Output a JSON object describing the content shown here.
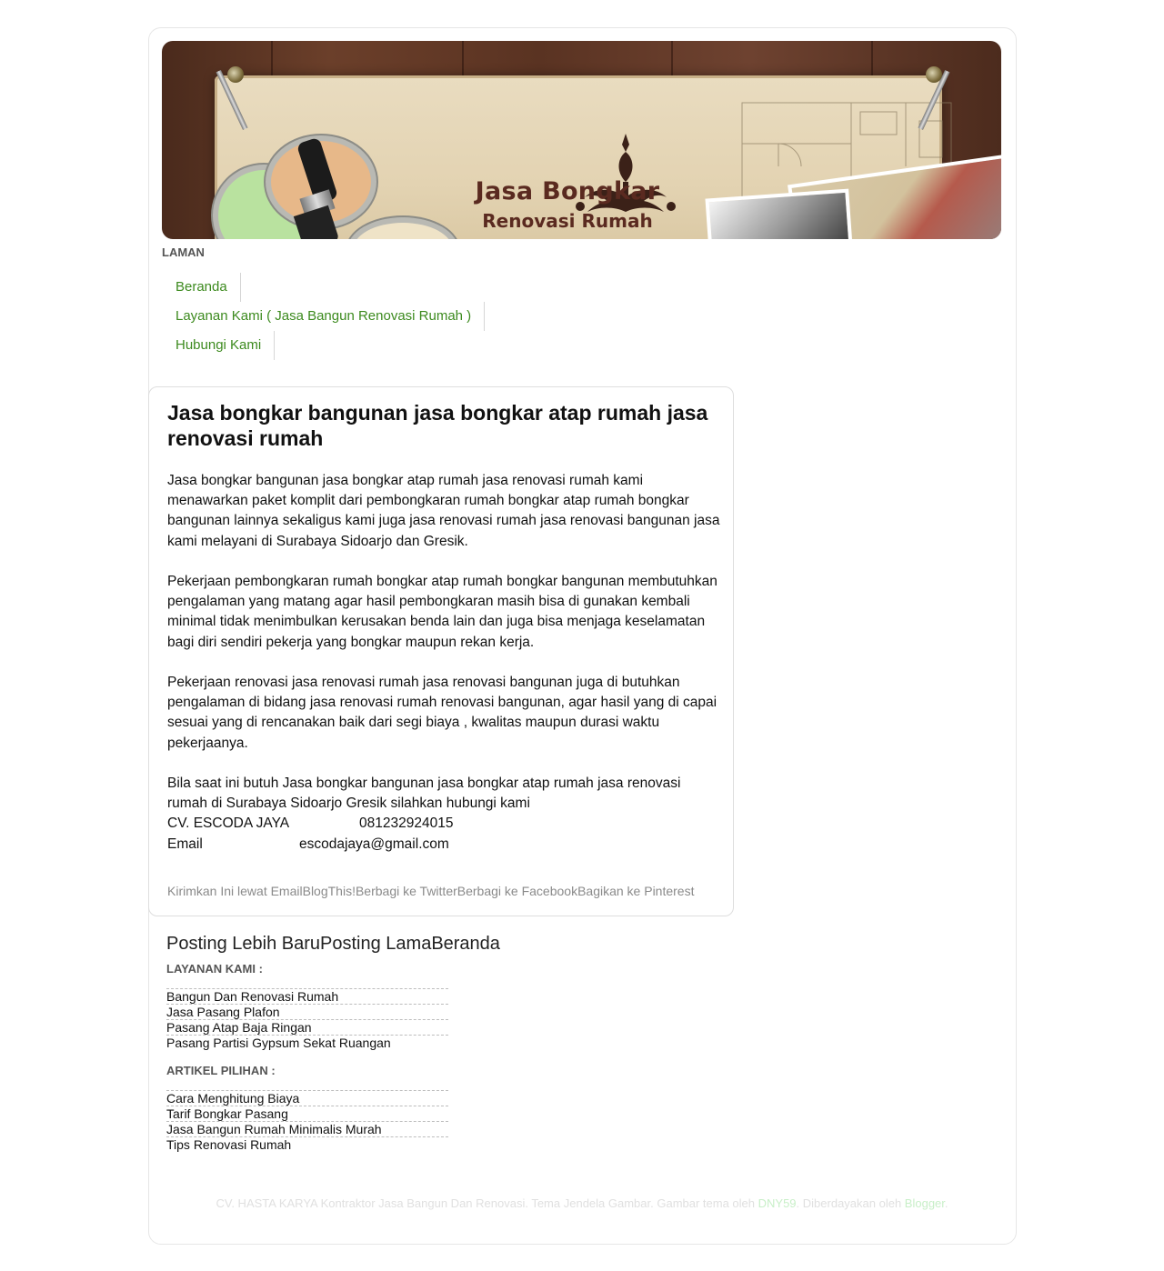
{
  "header": {
    "logo_line1": "Jasa Bongkar",
    "logo_line2": "Renovasi Rumah"
  },
  "pages": {
    "title": "LAMAN",
    "items": [
      {
        "label": "Beranda"
      },
      {
        "label": "Layanan Kami ( Jasa Bangun Renovasi Rumah )"
      },
      {
        "label": "Hubungi Kami"
      }
    ]
  },
  "post": {
    "title": "Jasa bongkar bangunan jasa bongkar atap rumah jasa renovasi rumah",
    "paragraphs": [
      "Jasa bongkar bangunan jasa bongkar atap rumah jasa renovasi rumah kami menawarkan paket komplit dari pembongkaran rumah bongkar atap rumah bongkar bangunan lainnya sekaligus kami juga jasa renovasi rumah jasa renovasi bangunan jasa kami melayani di Surabaya Sidoarjo dan Gresik.",
      "Pekerjaan pembongkaran rumah bongkar atap rumah bongkar bangunan membutuhkan pengalaman yang matang agar hasil pembongkaran masih bisa di gunakan kembali minimal tidak menimbulkan kerusakan benda lain dan juga bisa menjaga keselamatan bagi diri sendiri pekerja yang bongkar maupun rekan kerja.",
      "Pekerjaan renovasi jasa renovasi rumah jasa renovasi bangunan juga di butuhkan pengalaman di bidang jasa renovasi rumah renovasi bangunan, agar hasil yang di capai sesuai yang di rencanakan baik dari segi biaya , kwalitas maupun durasi waktu pekerjaanya.",
      "Bila saat ini butuh Jasa bongkar bangunan jasa bongkar atap rumah jasa renovasi rumah di Surabaya Sidoarjo Gresik silahkan hubungi kami"
    ],
    "contact": {
      "company": "CV. ESCODA JAYA",
      "phone": "081232924015",
      "email_label": "Email",
      "email": "escodajaya@gmail.com"
    },
    "share": {
      "email": "Kirimkan Ini lewat Email",
      "blogthis": "BlogThis!",
      "twitter": "Berbagi ke Twitter",
      "facebook": "Berbagi ke Facebook",
      "pinterest": "Bagikan ke Pinterest"
    }
  },
  "post_nav": {
    "newer": "Posting Lebih Baru",
    "older": "Posting Lama",
    "home": "Beranda"
  },
  "widgets": {
    "layanan": {
      "title": "LAYANAN KAMI :",
      "items": [
        "Bangun Dan Renovasi Rumah",
        "Jasa Pasang Plafon",
        "Pasang Atap Baja Ringan",
        "Pasang Partisi Gypsum Sekat Ruangan"
      ]
    },
    "artikel": {
      "title": "ARTIKEL PILIHAN :",
      "items": [
        "Cara Menghitung Biaya",
        "Tarif Bongkar Pasang",
        "Jasa Bangun Rumah Minimalis Murah",
        "Tips Renovasi Rumah"
      ]
    }
  },
  "footer": {
    "text": "CV. HASTA KARYA Kontraktor Jasa Bangun Dan Renovasi. Tema Jendela Gambar. Gambar tema oleh ",
    "author": "DNY59",
    "powered": ". Diberdayakan oleh ",
    "blogger": "Blogger",
    "end": "."
  },
  "colors": {
    "link_green": "#3c8a1e",
    "header_wood": "#5a3322",
    "logo_text": "#5a2a20"
  }
}
